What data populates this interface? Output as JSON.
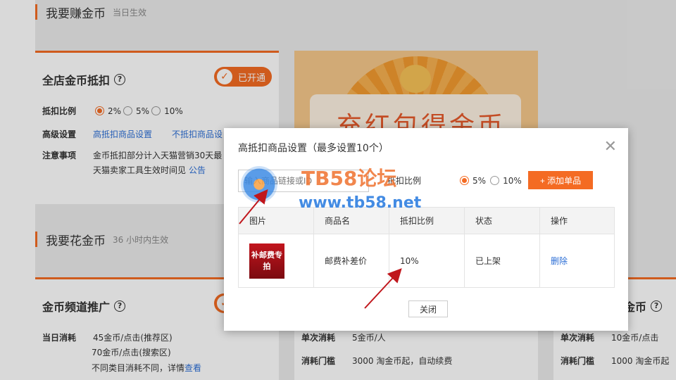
{
  "earn_section": {
    "title": "我要赚金币",
    "subtitle": "当日生效"
  },
  "spend_section": {
    "title": "我要花金币",
    "subtitle": "36 小时内生效"
  },
  "store_deduct": {
    "title": "全店金币抵扣",
    "status_button": "已开通",
    "ratio_label": "抵扣比例",
    "ratio_options": [
      "2%",
      "5%",
      "10%"
    ],
    "selected_ratio": "2%",
    "advanced_label": "高级设置",
    "link_high": "高抵扣商品设置",
    "link_no": "不抵扣商品设",
    "notes_label": "注意事项",
    "notes_line1": "金币抵扣部分计入天猫营销30天最",
    "notes_line2": "天猫卖家工具生效时间见",
    "notes_link": "公告"
  },
  "promo": {
    "text": "充红包得金币"
  },
  "channel_card": {
    "title": "金币频道推广",
    "daily_label": "当日消耗",
    "line1": "45金币/点击(推荐区)",
    "line2": "70金币/点击(搜索区)",
    "line3": "不同类目消耗不同，详情",
    "line3_link": "查看"
  },
  "mid_card": {
    "single_label": "单次消耗",
    "single_value": "5金币/人",
    "threshold_label": "消耗门槛",
    "threshold_value": "3000 淘金币起，自动续费"
  },
  "right_card": {
    "title": "金币",
    "single_label": "单次消耗",
    "single_value": "10金币/点击",
    "threshold_label": "消耗门槛",
    "threshold_value": "1000 淘金币起"
  },
  "modal": {
    "title": "高抵扣商品设置（最多设置10个）",
    "input_placeholder": "输入商品链接或ID",
    "ratio_label": "抵扣比例",
    "ratio_options": [
      "5%",
      "10%"
    ],
    "selected_ratio": "5%",
    "add_button": "+ 添加单品",
    "columns": [
      "图片",
      "商品名",
      "抵扣比例",
      "状态",
      "操作"
    ],
    "rows": [
      {
        "image_text": "补邮费专拍",
        "name": "邮费补差价",
        "ratio": "10%",
        "status": "已上架",
        "action": "删除"
      }
    ],
    "close_button": "关闭"
  },
  "watermark": {
    "line1": "TB58论坛",
    "line2": "www.tb58.net"
  },
  "colors": {
    "accent": "#f46b23",
    "link": "#2d6fd6"
  }
}
